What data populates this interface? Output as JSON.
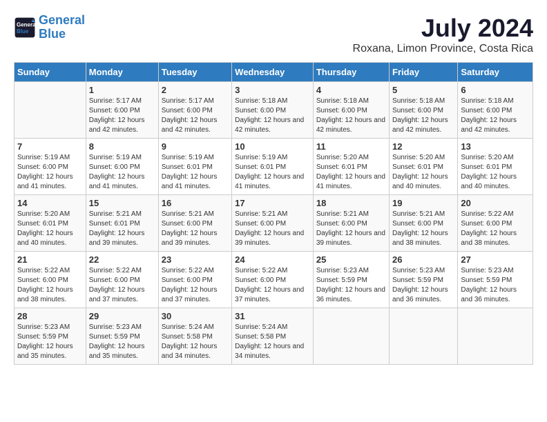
{
  "logo": {
    "line1": "General",
    "line2": "Blue"
  },
  "title": "July 2024",
  "subtitle": "Roxana, Limon Province, Costa Rica",
  "days_of_week": [
    "Sunday",
    "Monday",
    "Tuesday",
    "Wednesday",
    "Thursday",
    "Friday",
    "Saturday"
  ],
  "weeks": [
    [
      {
        "day": "",
        "sunrise": "",
        "sunset": "",
        "daylight": ""
      },
      {
        "day": "1",
        "sunrise": "Sunrise: 5:17 AM",
        "sunset": "Sunset: 6:00 PM",
        "daylight": "Daylight: 12 hours and 42 minutes."
      },
      {
        "day": "2",
        "sunrise": "Sunrise: 5:17 AM",
        "sunset": "Sunset: 6:00 PM",
        "daylight": "Daylight: 12 hours and 42 minutes."
      },
      {
        "day": "3",
        "sunrise": "Sunrise: 5:18 AM",
        "sunset": "Sunset: 6:00 PM",
        "daylight": "Daylight: 12 hours and 42 minutes."
      },
      {
        "day": "4",
        "sunrise": "Sunrise: 5:18 AM",
        "sunset": "Sunset: 6:00 PM",
        "daylight": "Daylight: 12 hours and 42 minutes."
      },
      {
        "day": "5",
        "sunrise": "Sunrise: 5:18 AM",
        "sunset": "Sunset: 6:00 PM",
        "daylight": "Daylight: 12 hours and 42 minutes."
      },
      {
        "day": "6",
        "sunrise": "Sunrise: 5:18 AM",
        "sunset": "Sunset: 6:00 PM",
        "daylight": "Daylight: 12 hours and 42 minutes."
      }
    ],
    [
      {
        "day": "7",
        "sunrise": "Sunrise: 5:19 AM",
        "sunset": "Sunset: 6:00 PM",
        "daylight": "Daylight: 12 hours and 41 minutes."
      },
      {
        "day": "8",
        "sunrise": "Sunrise: 5:19 AM",
        "sunset": "Sunset: 6:00 PM",
        "daylight": "Daylight: 12 hours and 41 minutes."
      },
      {
        "day": "9",
        "sunrise": "Sunrise: 5:19 AM",
        "sunset": "Sunset: 6:01 PM",
        "daylight": "Daylight: 12 hours and 41 minutes."
      },
      {
        "day": "10",
        "sunrise": "Sunrise: 5:19 AM",
        "sunset": "Sunset: 6:01 PM",
        "daylight": "Daylight: 12 hours and 41 minutes."
      },
      {
        "day": "11",
        "sunrise": "Sunrise: 5:20 AM",
        "sunset": "Sunset: 6:01 PM",
        "daylight": "Daylight: 12 hours and 41 minutes."
      },
      {
        "day": "12",
        "sunrise": "Sunrise: 5:20 AM",
        "sunset": "Sunset: 6:01 PM",
        "daylight": "Daylight: 12 hours and 40 minutes."
      },
      {
        "day": "13",
        "sunrise": "Sunrise: 5:20 AM",
        "sunset": "Sunset: 6:01 PM",
        "daylight": "Daylight: 12 hours and 40 minutes."
      }
    ],
    [
      {
        "day": "14",
        "sunrise": "Sunrise: 5:20 AM",
        "sunset": "Sunset: 6:01 PM",
        "daylight": "Daylight: 12 hours and 40 minutes."
      },
      {
        "day": "15",
        "sunrise": "Sunrise: 5:21 AM",
        "sunset": "Sunset: 6:01 PM",
        "daylight": "Daylight: 12 hours and 39 minutes."
      },
      {
        "day": "16",
        "sunrise": "Sunrise: 5:21 AM",
        "sunset": "Sunset: 6:00 PM",
        "daylight": "Daylight: 12 hours and 39 minutes."
      },
      {
        "day": "17",
        "sunrise": "Sunrise: 5:21 AM",
        "sunset": "Sunset: 6:00 PM",
        "daylight": "Daylight: 12 hours and 39 minutes."
      },
      {
        "day": "18",
        "sunrise": "Sunrise: 5:21 AM",
        "sunset": "Sunset: 6:00 PM",
        "daylight": "Daylight: 12 hours and 39 minutes."
      },
      {
        "day": "19",
        "sunrise": "Sunrise: 5:21 AM",
        "sunset": "Sunset: 6:00 PM",
        "daylight": "Daylight: 12 hours and 38 minutes."
      },
      {
        "day": "20",
        "sunrise": "Sunrise: 5:22 AM",
        "sunset": "Sunset: 6:00 PM",
        "daylight": "Daylight: 12 hours and 38 minutes."
      }
    ],
    [
      {
        "day": "21",
        "sunrise": "Sunrise: 5:22 AM",
        "sunset": "Sunset: 6:00 PM",
        "daylight": "Daylight: 12 hours and 38 minutes."
      },
      {
        "day": "22",
        "sunrise": "Sunrise: 5:22 AM",
        "sunset": "Sunset: 6:00 PM",
        "daylight": "Daylight: 12 hours and 37 minutes."
      },
      {
        "day": "23",
        "sunrise": "Sunrise: 5:22 AM",
        "sunset": "Sunset: 6:00 PM",
        "daylight": "Daylight: 12 hours and 37 minutes."
      },
      {
        "day": "24",
        "sunrise": "Sunrise: 5:22 AM",
        "sunset": "Sunset: 6:00 PM",
        "daylight": "Daylight: 12 hours and 37 minutes."
      },
      {
        "day": "25",
        "sunrise": "Sunrise: 5:23 AM",
        "sunset": "Sunset: 5:59 PM",
        "daylight": "Daylight: 12 hours and 36 minutes."
      },
      {
        "day": "26",
        "sunrise": "Sunrise: 5:23 AM",
        "sunset": "Sunset: 5:59 PM",
        "daylight": "Daylight: 12 hours and 36 minutes."
      },
      {
        "day": "27",
        "sunrise": "Sunrise: 5:23 AM",
        "sunset": "Sunset: 5:59 PM",
        "daylight": "Daylight: 12 hours and 36 minutes."
      }
    ],
    [
      {
        "day": "28",
        "sunrise": "Sunrise: 5:23 AM",
        "sunset": "Sunset: 5:59 PM",
        "daylight": "Daylight: 12 hours and 35 minutes."
      },
      {
        "day": "29",
        "sunrise": "Sunrise: 5:23 AM",
        "sunset": "Sunset: 5:59 PM",
        "daylight": "Daylight: 12 hours and 35 minutes."
      },
      {
        "day": "30",
        "sunrise": "Sunrise: 5:24 AM",
        "sunset": "Sunset: 5:58 PM",
        "daylight": "Daylight: 12 hours and 34 minutes."
      },
      {
        "day": "31",
        "sunrise": "Sunrise: 5:24 AM",
        "sunset": "Sunset: 5:58 PM",
        "daylight": "Daylight: 12 hours and 34 minutes."
      },
      {
        "day": "",
        "sunrise": "",
        "sunset": "",
        "daylight": ""
      },
      {
        "day": "",
        "sunrise": "",
        "sunset": "",
        "daylight": ""
      },
      {
        "day": "",
        "sunrise": "",
        "sunset": "",
        "daylight": ""
      }
    ]
  ]
}
